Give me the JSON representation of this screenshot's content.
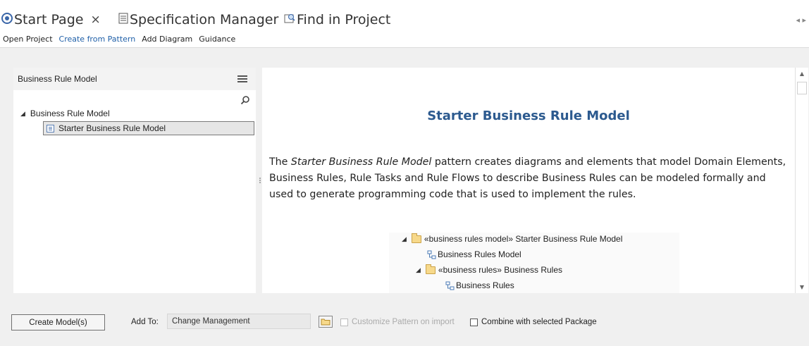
{
  "tabs": [
    {
      "label": "Start Page",
      "icon": "start-page-icon",
      "closable": true
    },
    {
      "label": "Specification Manager",
      "icon": "specification-icon"
    },
    {
      "label": "Find in Project",
      "icon": "find-icon"
    }
  ],
  "tab_close": "×",
  "subbar": {
    "items": [
      "Open Project",
      "Create from Pattern",
      "Add Diagram",
      "Guidance"
    ],
    "active_index": 1
  },
  "left_panel": {
    "header": "Business Rule Model",
    "tree_root": "Business Rule Model",
    "tree_child_selected": "Starter Business Rule Model"
  },
  "content": {
    "title": "Starter Business Rule Model",
    "text_pre": "The ",
    "text_italic": "Starter Business Rule Model",
    "text_post": " pattern creates diagrams and elements that model Domain Elements, Business Rules, Rule Tasks and Rule Flows to describe Business Rules can be modeled formally and used to generate programming code that is used to implement the rules.",
    "tree_preview": [
      "«business rules model» Starter Business Rule Model",
      "Business Rules Model",
      "«business rules» Business Rules",
      "Business Rules"
    ]
  },
  "bottom": {
    "create_button": "Create Model(s)",
    "add_to_label": "Add To:",
    "add_to_value": "Change Management",
    "customize_label": "Customize Pattern on import",
    "combine_label": "Combine with selected Package"
  },
  "colors": {
    "accent": "#2c5a8f",
    "link_active": "#1f5fa8",
    "folder": "#f7d98b"
  }
}
